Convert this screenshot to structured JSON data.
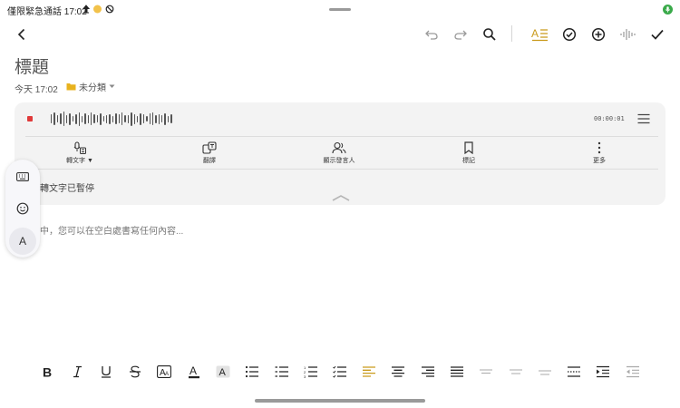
{
  "status_bar": {
    "text": "僅限緊急通話 17:02",
    "icons": [
      "upload-icon",
      "weather-icon",
      "no-disturb-icon"
    ]
  },
  "toolbar": {
    "icons": [
      "back-icon",
      "undo-icon",
      "redo-icon",
      "search-icon",
      "text-style-icon",
      "checkbox-icon",
      "add-icon",
      "voice-wave-icon",
      "done-icon"
    ],
    "accent": "#c99a1b"
  },
  "note": {
    "title": "標題",
    "time": "今天 17:02",
    "folder": "未分類",
    "placeholder": "中，您可以在空白處書寫任何內容..."
  },
  "recording": {
    "timer": "00:00:01",
    "status": "轉文字已暫停",
    "tools": [
      {
        "label": "轉文字 ▼",
        "icon": "transcribe-icon"
      },
      {
        "label": "翻譯",
        "icon": "translate-icon"
      },
      {
        "label": "顯示發言人",
        "icon": "speakers-icon"
      },
      {
        "label": "標記",
        "icon": "bookmark-icon"
      },
      {
        "label": "更多",
        "icon": "more-icon"
      }
    ]
  },
  "side_panel": {
    "letter": "A"
  },
  "format_bar": {
    "icons": [
      "bold-icon",
      "italic-icon",
      "underline-icon",
      "strikethrough-icon",
      "font-size-icon",
      "font-color-icon",
      "highlight-icon",
      "bullet-list-icon",
      "dash-list-icon",
      "number-list-icon",
      "checklist-icon",
      "align-left-icon",
      "align-center-icon",
      "align-right-icon",
      "justify-icon",
      "line-spacing-1-icon",
      "line-spacing-2-icon",
      "line-spacing-3-icon",
      "divider-icon",
      "indent-icon",
      "outdent-icon"
    ]
  }
}
